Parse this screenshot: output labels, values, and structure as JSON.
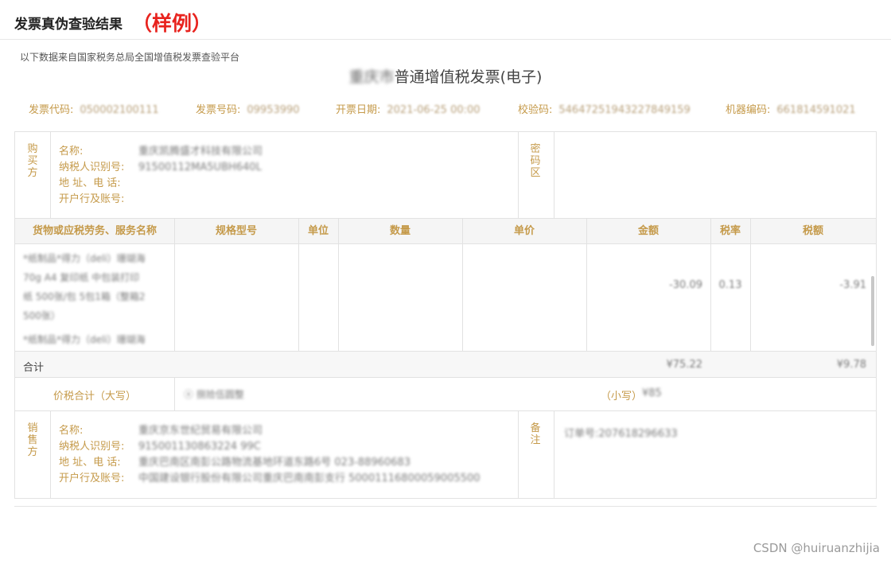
{
  "header": {
    "title": "发票真伪查验结果",
    "sample": "（样例）"
  },
  "source": "以下数据来自国家税务总局全国增值税发票查验平台",
  "invoice": {
    "city": "重庆市",
    "type": "普通增值税发票(电子)"
  },
  "codes": [
    {
      "label": "发票代码:",
      "value": "050002100111"
    },
    {
      "label": "发票号码:",
      "value": "09953990"
    },
    {
      "label": "开票日期:",
      "value": "2021-06-25 00:00"
    },
    {
      "label": "校验码:",
      "value": "54647251943227849159"
    },
    {
      "label": "机器编码:",
      "value": "661814591021"
    }
  ],
  "buyer": {
    "side_label": [
      "购",
      "买",
      "方"
    ],
    "name_label": "名称:",
    "name": "重庆凯腾盛才科技有限公司",
    "tax_label": "纳税人识别号:",
    "tax_id": "91500112MA5UBH640L",
    "addr_label": "地 址、电 话:",
    "bank_label": "开户行及账号:"
  },
  "password_label": [
    "密",
    "码",
    "区"
  ],
  "goods": {
    "headers": [
      "货物或应税劳务、服务名称",
      "规格型号",
      "单位",
      "数量",
      "单价",
      "金额",
      "税率",
      "税额"
    ],
    "item1": [
      "*纸制品*得力（deli）珊瑚海",
      "70g A4 复印纸 中包装打印",
      "纸 500张/包 5包1箱（整箱2",
      "500张）"
    ],
    "item2": "*纸制品*得力（deli）珊瑚海",
    "amount": "-30.09",
    "rate": "0.13",
    "tax": "-3.91",
    "total_label": "合计",
    "total_amount": "¥75.22",
    "total_tax": "¥9.78"
  },
  "tax_total": {
    "label": "价税合计（大写）",
    "upper": "ⓧ 捌拾伍圆整",
    "lower_label": "（小写）",
    "lower": "¥85"
  },
  "seller": {
    "side_label": [
      "销",
      "售",
      "方"
    ],
    "name_label": "名称:",
    "name": "重庆京东世纪贸易有限公司",
    "tax_label": "纳税人识别号:",
    "tax_id": "915001130863224 99C",
    "addr_label": "地 址、电 话:",
    "addr": "重庆巴南区南彭公路物流基地环道东路6号 023-88960683",
    "bank_label": "开户行及账号:",
    "bank": "中国建设银行股份有限公司重庆巴南南彭支行 50001116800059005500"
  },
  "remark_label": [
    "备",
    "注"
  ],
  "remark": "订单号:207618296633",
  "watermark": "CSDN @huiruanzhijia"
}
